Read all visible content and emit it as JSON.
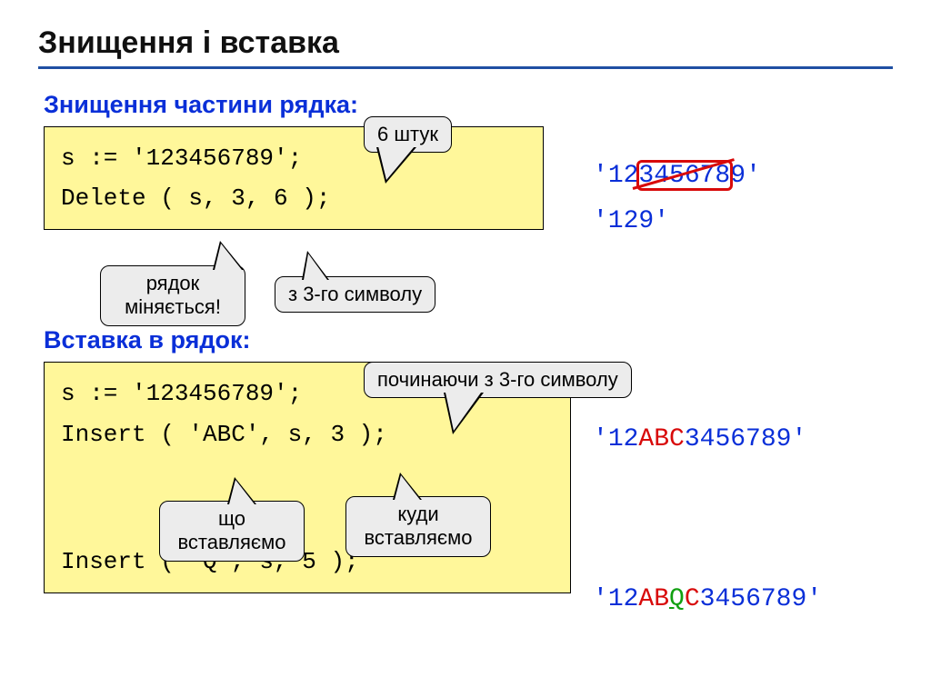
{
  "title": "Знищення і вставка",
  "sections": {
    "del": {
      "heading": "Знищення частини рядка:",
      "code_l1": "s := '123456789';",
      "code_l2": "Delete ( s, 3, 6 );",
      "callouts": {
        "count": "6 штук",
        "row_changes": "рядок міняється!",
        "from3": "з 3-го символу"
      },
      "result1": {
        "q1": "'",
        "p1": "12",
        "strike": "345678",
        "p2": "9",
        "q2": "'"
      },
      "result2": "'129'"
    },
    "ins": {
      "heading": "Вставка в рядок:",
      "code_l1": "s := '123456789';",
      "code_l2": "Insert ( 'ABC', s, 3 );",
      "code_l3": "Insert ( 'Q', s, 5 );",
      "callouts": {
        "start3": "починаючи з 3-го символу",
        "what": "що вставляємо",
        "where": "куди вставляємо"
      },
      "result1": {
        "q1": "'",
        "p1": "12",
        "ins": "ABC",
        "p2": "3456789",
        "q2": "'"
      },
      "result2": {
        "q1": "'",
        "p1": "12",
        "a": "AB",
        "q": "Q",
        "c": "C",
        "p2": "3456789",
        "q2": "'"
      }
    }
  }
}
